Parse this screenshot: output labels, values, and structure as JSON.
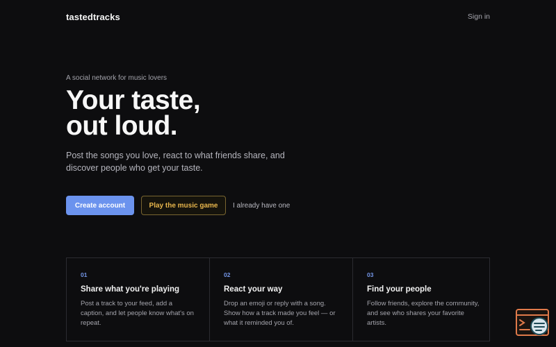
{
  "header": {
    "logo": "tastedtracks",
    "signin_label": "Sign in"
  },
  "hero": {
    "eyebrow": "A social network for music lovers",
    "headline_line1": "Your taste,",
    "headline_line2": "out loud.",
    "subtext": "Post the songs you love, react to what friends share, and discover people who get your taste."
  },
  "cta": {
    "create_account_label": "Create account",
    "play_game_label": "Play the music game",
    "already_have_label": "I already have one"
  },
  "features": [
    {
      "num": "01",
      "title": "Share what you're playing",
      "desc": "Post a track to your feed, add a caption, and let people know what's on repeat."
    },
    {
      "num": "02",
      "title": "React your way",
      "desc": "Drop an emoji or reply with a song. Show how a track made you feel — or what it reminded you of."
    },
    {
      "num": "03",
      "title": "Find your people",
      "desc": "Follow friends, explore the community, and see who shares your favorite artists."
    }
  ],
  "colors": {
    "background": "#0d0d0f",
    "primary_button": "#6b93ee",
    "game_button_text": "#e8b64c",
    "feature_number": "#7496e8",
    "widget_accent": "#e07a4a"
  },
  "widget": {
    "icon": "terminal-chat-icon"
  }
}
